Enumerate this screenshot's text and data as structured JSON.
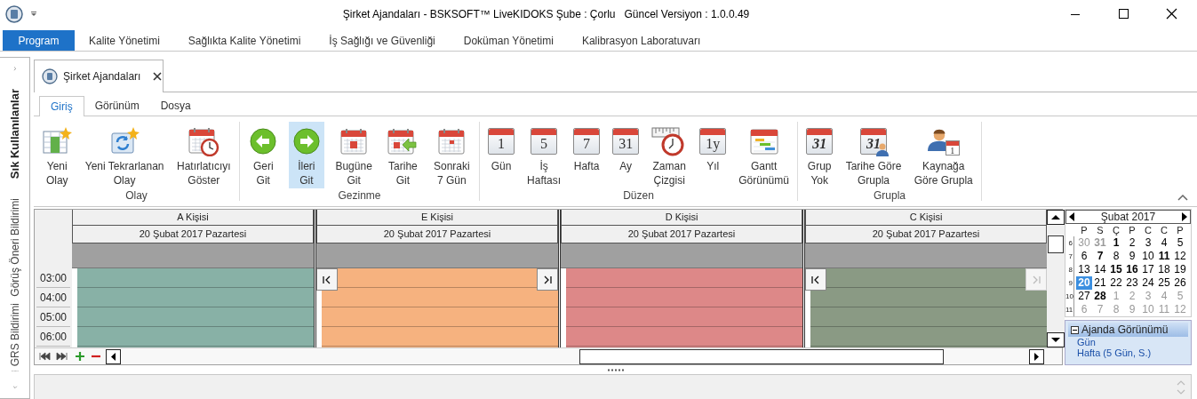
{
  "window": {
    "title": "Şirket Ajandaları - BSKSOFT™ LiveKIDOKS Şube : Çorlu   Güncel Versiyon : 1.0.0.49"
  },
  "menu": [
    {
      "label": "Program",
      "selected": true
    },
    {
      "label": "Kalite Yönetimi",
      "selected": false
    },
    {
      "label": "Sağlıkta Kalite Yönetimi",
      "selected": false
    },
    {
      "label": "İş Sağlığı ve Güvenliği",
      "selected": false
    },
    {
      "label": "Doküman Yönetimi",
      "selected": false
    },
    {
      "label": "Kalibrasyon Laboratuvarı",
      "selected": false
    }
  ],
  "sidebar": {
    "items": [
      {
        "label": "Sık Kullanılanlar",
        "kind": "header"
      },
      {
        "label": "Görüş Öneri Bildirimi",
        "kind": "item"
      },
      {
        "label": "GRS Bildirimi",
        "kind": "item"
      }
    ]
  },
  "document_tabs": [
    {
      "label": "Şirket Ajandaları",
      "selected": true
    }
  ],
  "ribbon": {
    "tabs": [
      {
        "label": "Giriş",
        "selected": true
      },
      {
        "label": "Görünüm",
        "selected": false
      },
      {
        "label": "Dosya",
        "selected": false
      }
    ],
    "groups": [
      {
        "label": "Olay",
        "buttons": [
          {
            "label": "Yeni\nOlay",
            "kind": "new-event",
            "selected": false
          },
          {
            "label": "Yeni Tekrarlanan\nOlay",
            "kind": "recurring",
            "selected": false
          },
          {
            "label": "Hatırlatıcıyı\nGöster",
            "kind": "reminder",
            "selected": false
          }
        ]
      },
      {
        "label": "Gezinme",
        "buttons": [
          {
            "label": "Geri\nGit",
            "kind": "back",
            "selected": false
          },
          {
            "label": "İleri\nGit",
            "kind": "forward",
            "selected": true
          },
          {
            "label": "Bugüne\nGit",
            "kind": "today",
            "selected": false
          },
          {
            "label": "Tarihe\nGit",
            "kind": "goto-date",
            "selected": false
          },
          {
            "label": "Sonraki\n7 Gün",
            "kind": "next7",
            "selected": false
          }
        ]
      },
      {
        "label": "Düzen",
        "buttons": [
          {
            "label": "Gün",
            "kind": "number",
            "icon_text": "1",
            "selected": false
          },
          {
            "label": "İş\nHaftası",
            "kind": "number",
            "icon_text": "5",
            "selected": false
          },
          {
            "label": "Hafta",
            "kind": "number",
            "icon_text": "7",
            "selected": false
          },
          {
            "label": "Ay",
            "kind": "number",
            "icon_text": "31",
            "selected": false
          },
          {
            "label": "Zaman\nÇizgisi",
            "kind": "timeline",
            "selected": false
          },
          {
            "label": "Yıl",
            "kind": "number",
            "icon_text": "1y",
            "selected": false
          },
          {
            "label": "Gantt\nGörünümü",
            "kind": "gantt",
            "selected": false
          }
        ]
      },
      {
        "label": "Grupla",
        "buttons": [
          {
            "label": "Grup\nYok",
            "kind": "number-italic",
            "icon_text": "31",
            "selected": false
          },
          {
            "label": "Tarihe Göre\nGrupla",
            "kind": "number-person",
            "icon_text": "31",
            "selected": false
          },
          {
            "label": "Kaynağa\nGöre Grupla",
            "kind": "person-calendar",
            "icon_text": "1",
            "selected": false
          }
        ]
      }
    ]
  },
  "scheduler": {
    "time_slots": [
      "03:00",
      "04:00",
      "05:00",
      "06:00"
    ],
    "resources": [
      {
        "name": "A Kişisi",
        "date": "20 Şubat 2017 Pazartesi",
        "color": "#88b1a6"
      },
      {
        "name": "E Kişisi",
        "date": "20 Şubat 2017 Pazartesi",
        "color": "#f6b27f",
        "nav_buttons": [
          {
            "kind": "prev",
            "disabled": false
          },
          {
            "kind": "next",
            "disabled": false
          }
        ]
      },
      {
        "name": "D Kişisi",
        "date": "20 Şubat 2017 Pazartesi",
        "color": "#dd8888"
      },
      {
        "name": "C Kişisi",
        "date": "20 Şubat 2017 Pazartesi",
        "color": "#8a9a84",
        "nav_buttons": [
          {
            "kind": "prev",
            "disabled": false
          },
          {
            "kind": "next",
            "disabled": true
          }
        ]
      }
    ]
  },
  "calendar": {
    "title": "Şubat 2017",
    "weekdays": [
      "P",
      "S",
      "Ç",
      "P",
      "C",
      "C",
      "P"
    ],
    "weeks": [
      {
        "number": "6",
        "days": [
          {
            "day": "30",
            "muted": true,
            "bold": false,
            "selected": false
          },
          {
            "day": "31",
            "muted": true,
            "bold": true,
            "selected": false
          },
          {
            "day": "1",
            "muted": false,
            "bold": true,
            "selected": false
          },
          {
            "day": "2",
            "muted": false,
            "bold": false,
            "selected": false
          },
          {
            "day": "3",
            "muted": false,
            "bold": false,
            "selected": false
          },
          {
            "day": "4",
            "muted": false,
            "bold": false,
            "selected": false
          },
          {
            "day": "5",
            "muted": false,
            "bold": false,
            "selected": false
          }
        ]
      },
      {
        "number": "7",
        "days": [
          {
            "day": "6",
            "muted": false,
            "bold": false,
            "selected": false
          },
          {
            "day": "7",
            "muted": false,
            "bold": true,
            "selected": false
          },
          {
            "day": "8",
            "muted": false,
            "bold": false,
            "selected": false
          },
          {
            "day": "9",
            "muted": false,
            "bold": false,
            "selected": false
          },
          {
            "day": "10",
            "muted": false,
            "bold": false,
            "selected": false
          },
          {
            "day": "11",
            "muted": false,
            "bold": true,
            "selected": false
          },
          {
            "day": "12",
            "muted": false,
            "bold": false,
            "selected": false
          }
        ]
      },
      {
        "number": "8",
        "days": [
          {
            "day": "13",
            "muted": false,
            "bold": false,
            "selected": false
          },
          {
            "day": "14",
            "muted": false,
            "bold": false,
            "selected": false
          },
          {
            "day": "15",
            "muted": false,
            "bold": true,
            "selected": false
          },
          {
            "day": "16",
            "muted": false,
            "bold": true,
            "selected": false
          },
          {
            "day": "17",
            "muted": false,
            "bold": false,
            "selected": false
          },
          {
            "day": "18",
            "muted": false,
            "bold": false,
            "selected": false
          },
          {
            "day": "19",
            "muted": false,
            "bold": false,
            "selected": false
          }
        ]
      },
      {
        "number": "9",
        "days": [
          {
            "day": "20",
            "muted": false,
            "bold": true,
            "selected": true
          },
          {
            "day": "21",
            "muted": false,
            "bold": false,
            "selected": false
          },
          {
            "day": "22",
            "muted": false,
            "bold": false,
            "selected": false
          },
          {
            "day": "23",
            "muted": false,
            "bold": false,
            "selected": false
          },
          {
            "day": "24",
            "muted": false,
            "bold": false,
            "selected": false
          },
          {
            "day": "25",
            "muted": false,
            "bold": false,
            "selected": false
          },
          {
            "day": "26",
            "muted": false,
            "bold": false,
            "selected": false
          }
        ]
      },
      {
        "number": "10",
        "days": [
          {
            "day": "27",
            "muted": false,
            "bold": false,
            "selected": false
          },
          {
            "day": "28",
            "muted": false,
            "bold": true,
            "selected": false
          },
          {
            "day": "1",
            "muted": true,
            "bold": false,
            "selected": false
          },
          {
            "day": "2",
            "muted": true,
            "bold": false,
            "selected": false
          },
          {
            "day": "3",
            "muted": true,
            "bold": false,
            "selected": false
          },
          {
            "day": "4",
            "muted": true,
            "bold": false,
            "selected": false
          },
          {
            "day": "5",
            "muted": true,
            "bold": false,
            "selected": false
          }
        ]
      },
      {
        "number": "11",
        "days": [
          {
            "day": "6",
            "muted": true,
            "bold": false,
            "selected": false
          },
          {
            "day": "7",
            "muted": true,
            "bold": false,
            "selected": false
          },
          {
            "day": "8",
            "muted": true,
            "bold": false,
            "selected": false
          },
          {
            "day": "9",
            "muted": true,
            "bold": false,
            "selected": false
          },
          {
            "day": "10",
            "muted": true,
            "bold": false,
            "selected": false
          },
          {
            "day": "11",
            "muted": true,
            "bold": false,
            "selected": false
          },
          {
            "day": "12",
            "muted": true,
            "bold": false,
            "selected": false
          }
        ]
      }
    ]
  },
  "agenda_view": {
    "title": "Ajanda Görünümü",
    "items": [
      "Gün",
      "Hafta (5 Gün, S.)"
    ]
  }
}
